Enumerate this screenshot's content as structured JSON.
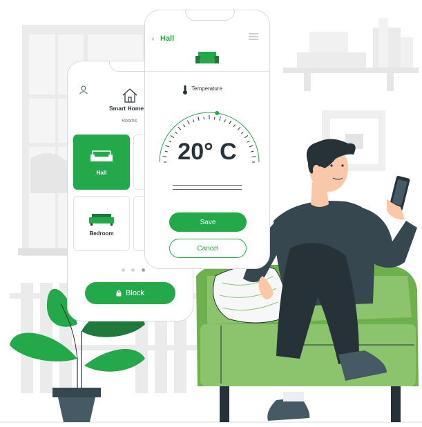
{
  "colors": {
    "accent": "#23a84a",
    "dark": "#263238",
    "sofa_green": "#8cc46d",
    "shirt": "#37474f"
  },
  "back_phone": {
    "title": "Smart Home",
    "subtitle": "Rooms",
    "rooms": [
      {
        "label": "Hall",
        "icon": "sofa-icon"
      },
      {
        "label": "",
        "icon": ""
      },
      {
        "label": "Bedroom",
        "icon": "bed-icon"
      },
      {
        "label": "",
        "icon": ""
      }
    ],
    "page_dots": 3,
    "block_button": {
      "label": "Block",
      "icon": "lock-icon"
    }
  },
  "front_phone": {
    "back_icon": "chevron-left-icon",
    "room_title": "Hall",
    "menu_icon": "hamburger-icon",
    "room_icon": "sofa-icon",
    "temperature_label": "Temperature",
    "temperature_reading": "20° C",
    "save_label": "Save",
    "cancel_label": "Cancel"
  }
}
